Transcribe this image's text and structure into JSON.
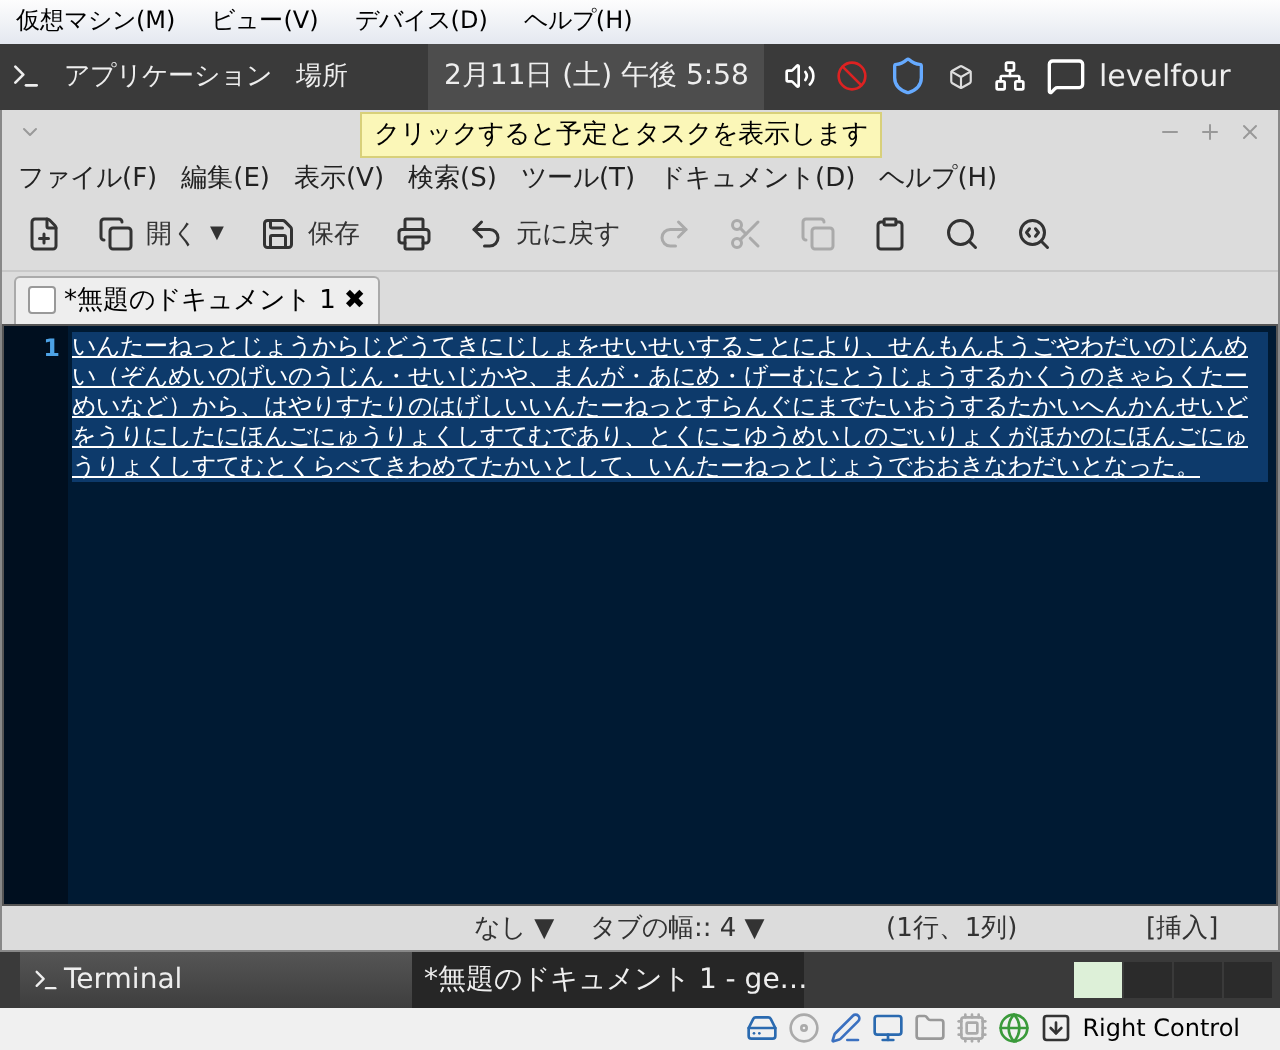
{
  "vm_menu": [
    "仮想マシン(M)",
    "ビュー(V)",
    "デバイス(D)",
    "ヘルプ(H)"
  ],
  "panel": {
    "apps": "アプリケーション",
    "places": "場所",
    "clock": "2月11日 (土) 午後 5:58",
    "user": "levelfour"
  },
  "tooltip": "クリックすると予定とタスクを表示します",
  "menu": [
    "ファイル(F)",
    "編集(E)",
    "表示(V)",
    "検索(S)",
    "ツール(T)",
    "ドキュメント(D)",
    "ヘルプ(H)"
  ],
  "toolbar": [
    {
      "kind": "new",
      "disabled": false
    },
    {
      "kind": "open",
      "label": "開く",
      "dropdown": "▼",
      "disabled": false
    },
    {
      "kind": "save",
      "label": "保存",
      "disabled": false
    },
    {
      "kind": "print",
      "disabled": false
    },
    {
      "kind": "undo",
      "label": "元に戻す",
      "disabled": false
    },
    {
      "kind": "redo",
      "disabled": true
    },
    {
      "kind": "cut",
      "disabled": true
    },
    {
      "kind": "copy",
      "disabled": true
    },
    {
      "kind": "paste",
      "disabled": false
    },
    {
      "kind": "find",
      "disabled": false
    },
    {
      "kind": "replace",
      "disabled": false
    }
  ],
  "tab": {
    "title": "*無題のドキュメント 1",
    "close": "✖"
  },
  "editor": {
    "line_number": "1",
    "selected": true,
    "text": "いんたーねっとじょうからじどうてきにじしょをせいせいすることにより、せんもんようごやわだいのじんめい（ぞんめいのげいのうじん・せいじかや、まんが・あにめ・げーむにとうじょうするかくうのきゃらくたーめいなど）から、はやりすたりのはげしいいんたーねっとすらんぐにまでたいおうするたかいへんかんせいどをうりにしたにほんごにゅうりょくしすてむであり、とくにこゆうめいしのごいりょくがほかのにほんごにゅうりょくしすてむとくらべてきわめてたかいとして、いんたーねっとじょうでおおきなわだいとなった。"
  },
  "status": {
    "language": "なし ▼",
    "tab_width": "タブの幅:: 4 ▼",
    "position": "(1行、1列)",
    "mode": "[挿入]"
  },
  "taskbar": [
    {
      "label": "Terminal",
      "selected": false
    },
    {
      "label": "*無題のドキュメント 1 - ge…",
      "selected": true
    }
  ],
  "workspaces": [
    {
      "selected": true
    },
    {
      "selected": false
    },
    {
      "selected": false
    },
    {
      "selected": false
    }
  ],
  "host_key": "Right Control"
}
